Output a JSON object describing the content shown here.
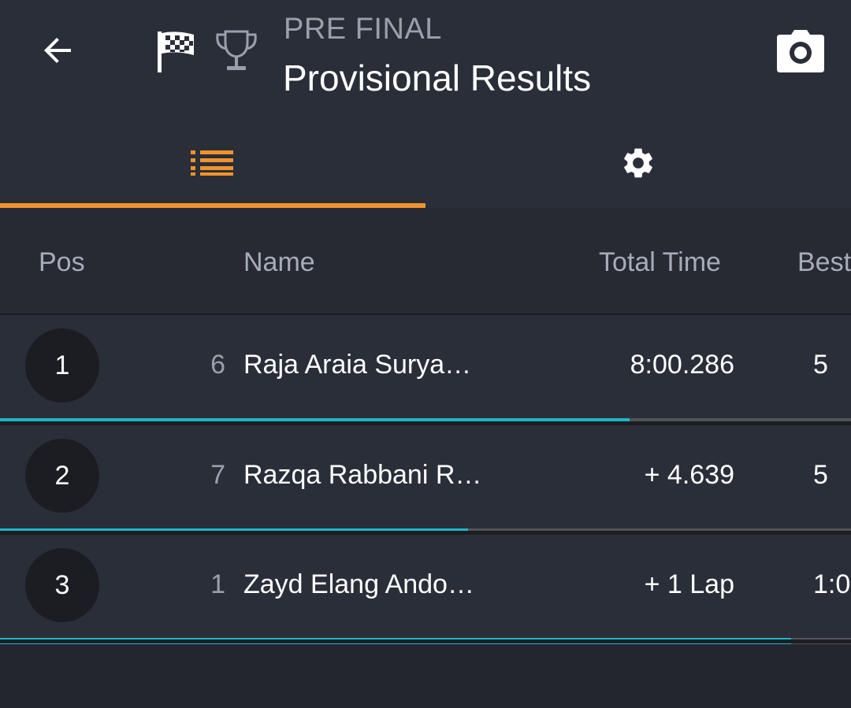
{
  "header": {
    "session_label": "PRE FINAL",
    "title": "Provisional Results",
    "back_icon": "arrow-left-icon",
    "flag_icon": "checkered-flag-icon",
    "trophy_icon": "trophy-icon",
    "camera_icon": "camera-icon"
  },
  "tabs": [
    {
      "icon": "list-icon",
      "active": true
    },
    {
      "icon": "gear-icon",
      "active": false
    }
  ],
  "columns": {
    "pos": "Pos",
    "name": "Name",
    "total_time": "Total Time",
    "best": "Best"
  },
  "rows": [
    {
      "position": "1",
      "kart": "6",
      "name": "Raja Araia Surya…",
      "total_time": "8:00.286",
      "best": "5",
      "progress": 0.74
    },
    {
      "position": "2",
      "kart": "7",
      "name": "Razqa Rabbani R…",
      "total_time": "+ 4.639",
      "best": "5",
      "progress": 0.55
    },
    {
      "position": "3",
      "kart": "1",
      "name": "Zayd Elang Ando…",
      "total_time": "+ 1 Lap",
      "best": "1:0",
      "progress": 0.93
    }
  ],
  "colors": {
    "accent": "#f0932b",
    "progress": "#1fb6c9",
    "background": "#23262e",
    "surface": "#2a2e38"
  }
}
